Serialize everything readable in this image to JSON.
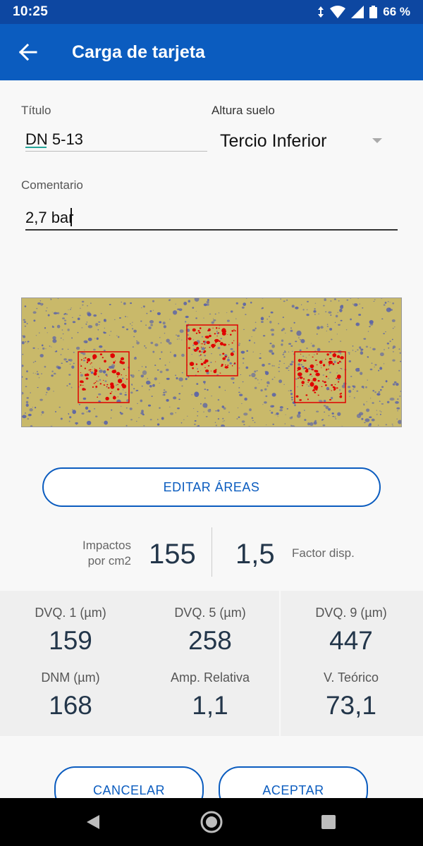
{
  "status_bar": {
    "time": "10:25",
    "battery": "66 %",
    "icons": [
      "data-arrows-icon",
      "wifi-icon",
      "signal-icon",
      "battery-icon"
    ]
  },
  "app_bar": {
    "title": "Carga de tarjeta",
    "back_icon": "arrow-left-icon"
  },
  "form": {
    "title_label": "Título",
    "title_value": "DN 5-13",
    "height_label": "Altura suelo",
    "height_value": "Tercio Inferior",
    "comment_label": "Comentario",
    "comment_value": "2,7 bar"
  },
  "edit_areas_label": "EDITAR ÁREAS",
  "stats": {
    "impacts_label_line1": "Impactos",
    "impacts_label_line2": "por cm2",
    "impacts_value": "155",
    "factor_value": "1,5",
    "factor_label": "Factor disp."
  },
  "grid": [
    {
      "label": "DVQ. 1 (µm)",
      "value": "159"
    },
    {
      "label": "DVQ. 5 (µm)",
      "value": "258"
    },
    {
      "label": "DVQ. 9 (µm)",
      "value": "447"
    },
    {
      "label": "DNM (µm)",
      "value": "168"
    },
    {
      "label": "Amp. Relativa",
      "value": "1,1"
    },
    {
      "label": "V. Teórico",
      "value": "73,1"
    }
  ],
  "actions": {
    "cancel_label": "CANCELAR",
    "accept_label": "ACEPTAR"
  },
  "colors": {
    "primary": "#0b5cbf",
    "status_bar": "#0d47a1",
    "card_background": "#c9b96a",
    "droplet": "#5a63a8",
    "area_box": "#e00000"
  }
}
